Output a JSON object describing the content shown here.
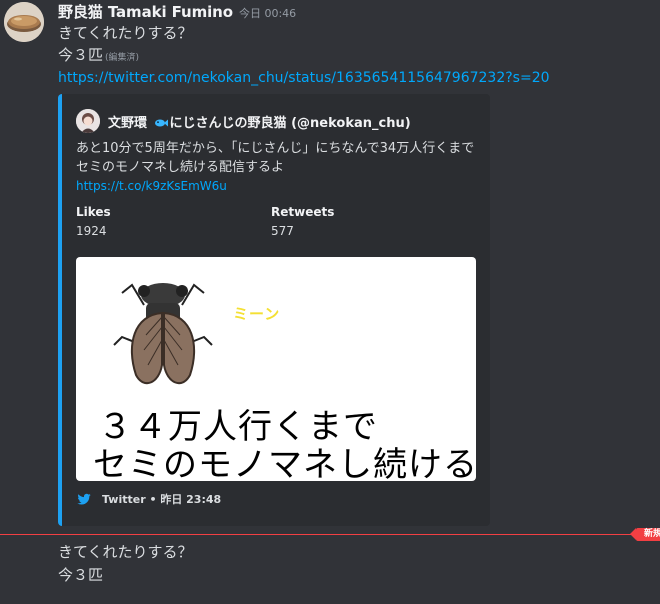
{
  "message": {
    "author": "野良猫 Tamaki Fumino",
    "timestamp": "今日 00:46",
    "line1": "きてくれたりする？",
    "line2": "今３匹",
    "edited": "(編集済)",
    "link": "https://twitter.com/nekokan_chu/status/1635654115647967232?s=20"
  },
  "embed": {
    "author_prefix": "文野環",
    "author_suffix": "にじさんじの野良猫 (@nekokan_chu)",
    "author_emoji": "fish-icon",
    "description": "あと10分で5周年だから、「にじさんじ」にちなんで34万人行くまでセミのモノマネし続ける配信するよ",
    "desc_link": "https://t.co/k9zKsEmW6u",
    "fields": [
      {
        "name": "Likes",
        "value": "1924"
      },
      {
        "name": "Retweets",
        "value": "577"
      }
    ],
    "image": {
      "sound_text": "ミーン",
      "caption_line1": "３４万人行くまで",
      "caption_line2": "セミのモノマネし続ける"
    },
    "footer": "Twitter • 昨日 23:48",
    "accent_color": "#1da1f2"
  },
  "divider": {
    "label": "新規"
  },
  "followup": {
    "line1": "きてくれたりする？",
    "line2": "今３匹"
  },
  "colors": {
    "background": "#313338",
    "embed_background": "#2b2d31",
    "link": "#00a8fc",
    "new_marker": "#f23f43"
  }
}
